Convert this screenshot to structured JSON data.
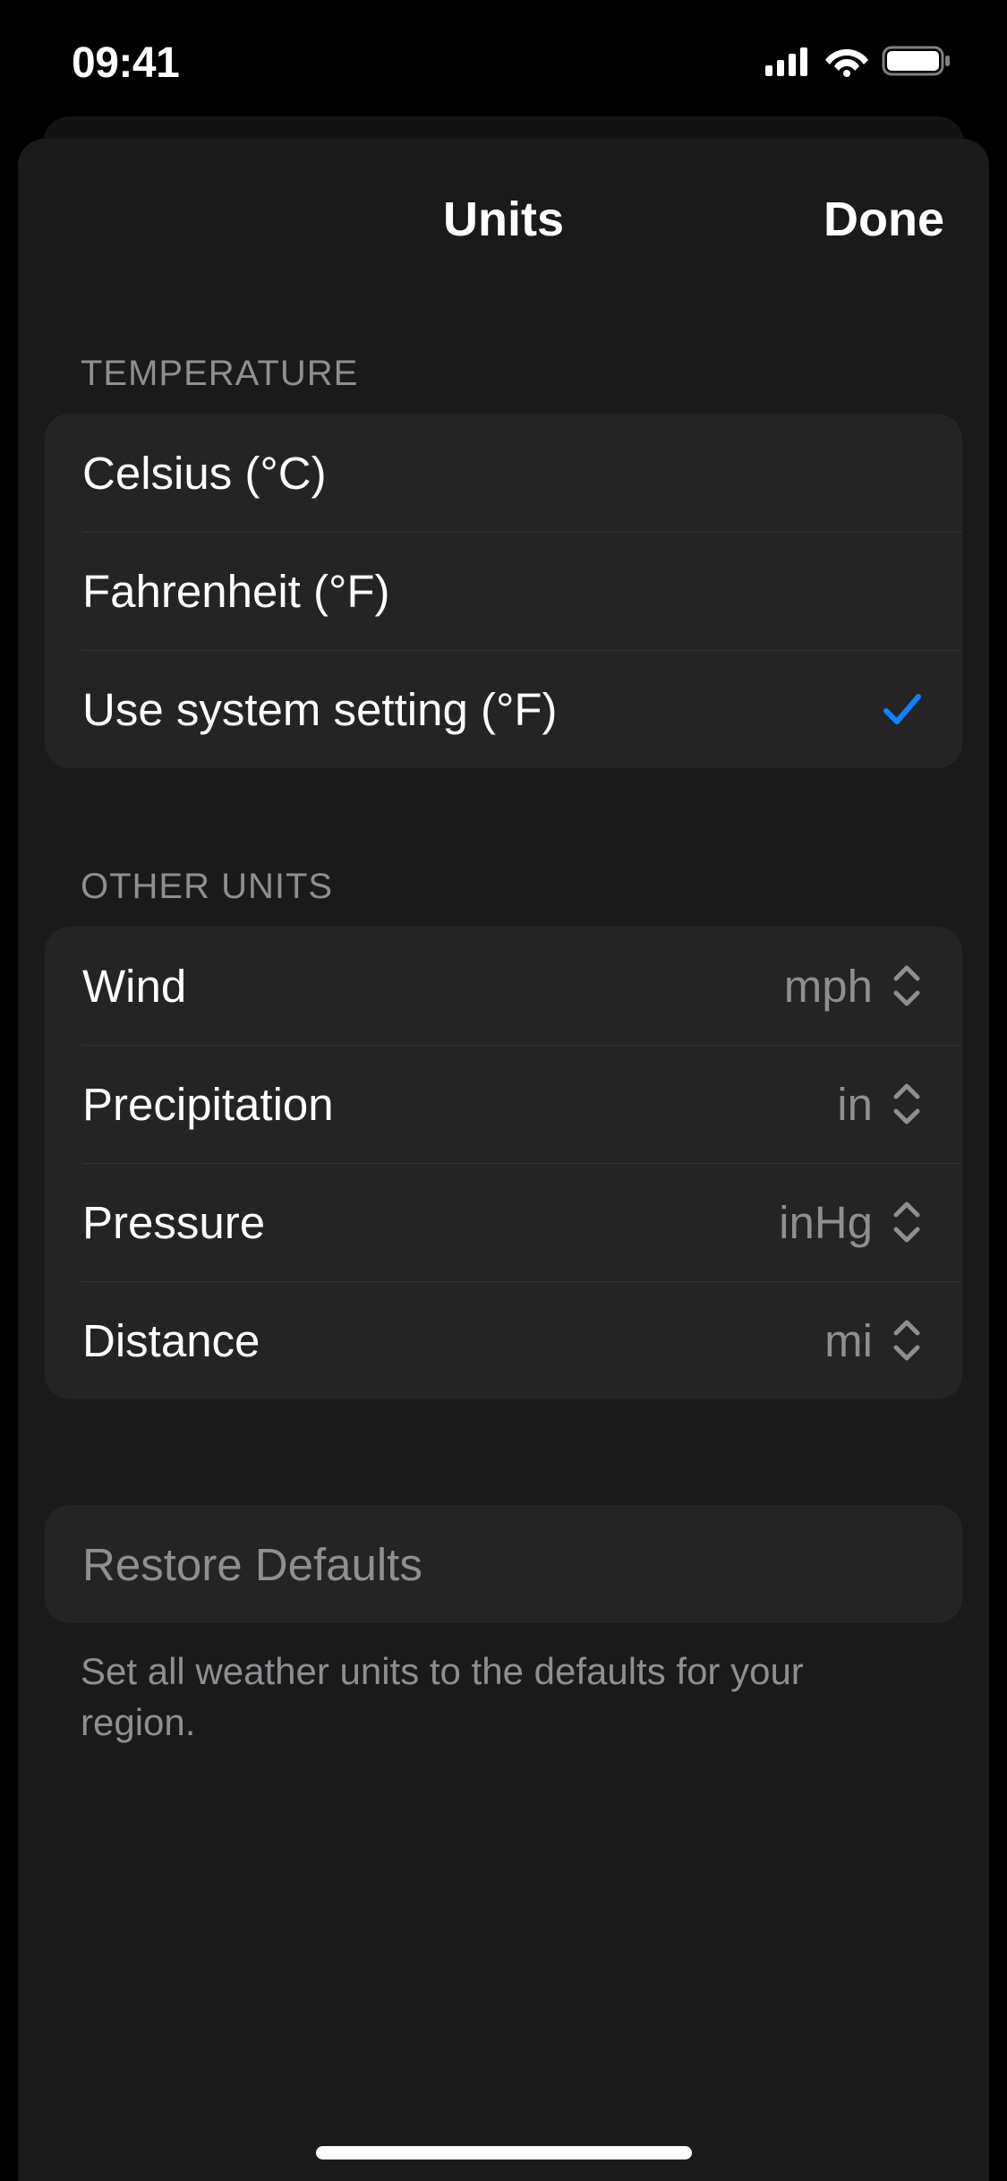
{
  "status": {
    "time": "09:41"
  },
  "sheet": {
    "title": "Units",
    "done_label": "Done"
  },
  "sections": {
    "temperature": {
      "header": "TEMPERATURE",
      "items": [
        {
          "label": "Celsius (°C)",
          "selected": false
        },
        {
          "label": "Fahrenheit (°F)",
          "selected": false
        },
        {
          "label": "Use system setting (°F)",
          "selected": true
        }
      ]
    },
    "other_units": {
      "header": "OTHER UNITS",
      "items": [
        {
          "label": "Wind",
          "value": "mph"
        },
        {
          "label": "Precipitation",
          "value": "in"
        },
        {
          "label": "Pressure",
          "value": "inHg"
        },
        {
          "label": "Distance",
          "value": "mi"
        }
      ]
    }
  },
  "restore": {
    "label": "Restore Defaults",
    "footer": "Set all weather units to the defaults for your region."
  },
  "colors": {
    "accent": "#0a84ff",
    "secondary": "#8e8e93"
  }
}
